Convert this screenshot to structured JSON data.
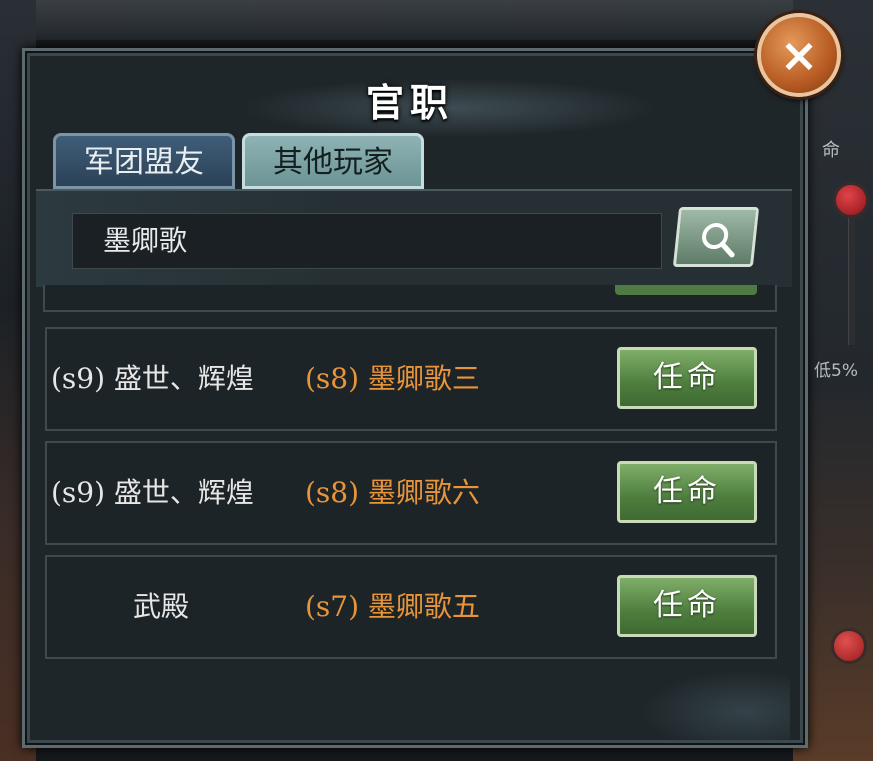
{
  "dialog": {
    "title": "官职",
    "close_label": "×"
  },
  "tabs": [
    {
      "label": "军团盟友",
      "active": false
    },
    {
      "label": "其他玩家",
      "active": true
    }
  ],
  "search": {
    "value": "墨卿歌",
    "icon": "search-icon"
  },
  "rows": [
    {
      "guild": "(s9) 盛世、辉煌",
      "player": "(s8) 墨卿歌三",
      "button": "任命"
    },
    {
      "guild": "(s9) 盛世、辉煌",
      "player": "(s8) 墨卿歌六",
      "button": "任命"
    },
    {
      "guild": "武殿",
      "player": "(s7) 墨卿歌五",
      "button": "任命"
    }
  ],
  "background": {
    "right_label_top": "命",
    "right_label_mid": "低5%"
  },
  "colors": {
    "accent_orange": "#e8953a",
    "button_green": "#4e7e3e",
    "tab_active": "#8fb3b4",
    "tab_inactive": "#2b4257"
  }
}
